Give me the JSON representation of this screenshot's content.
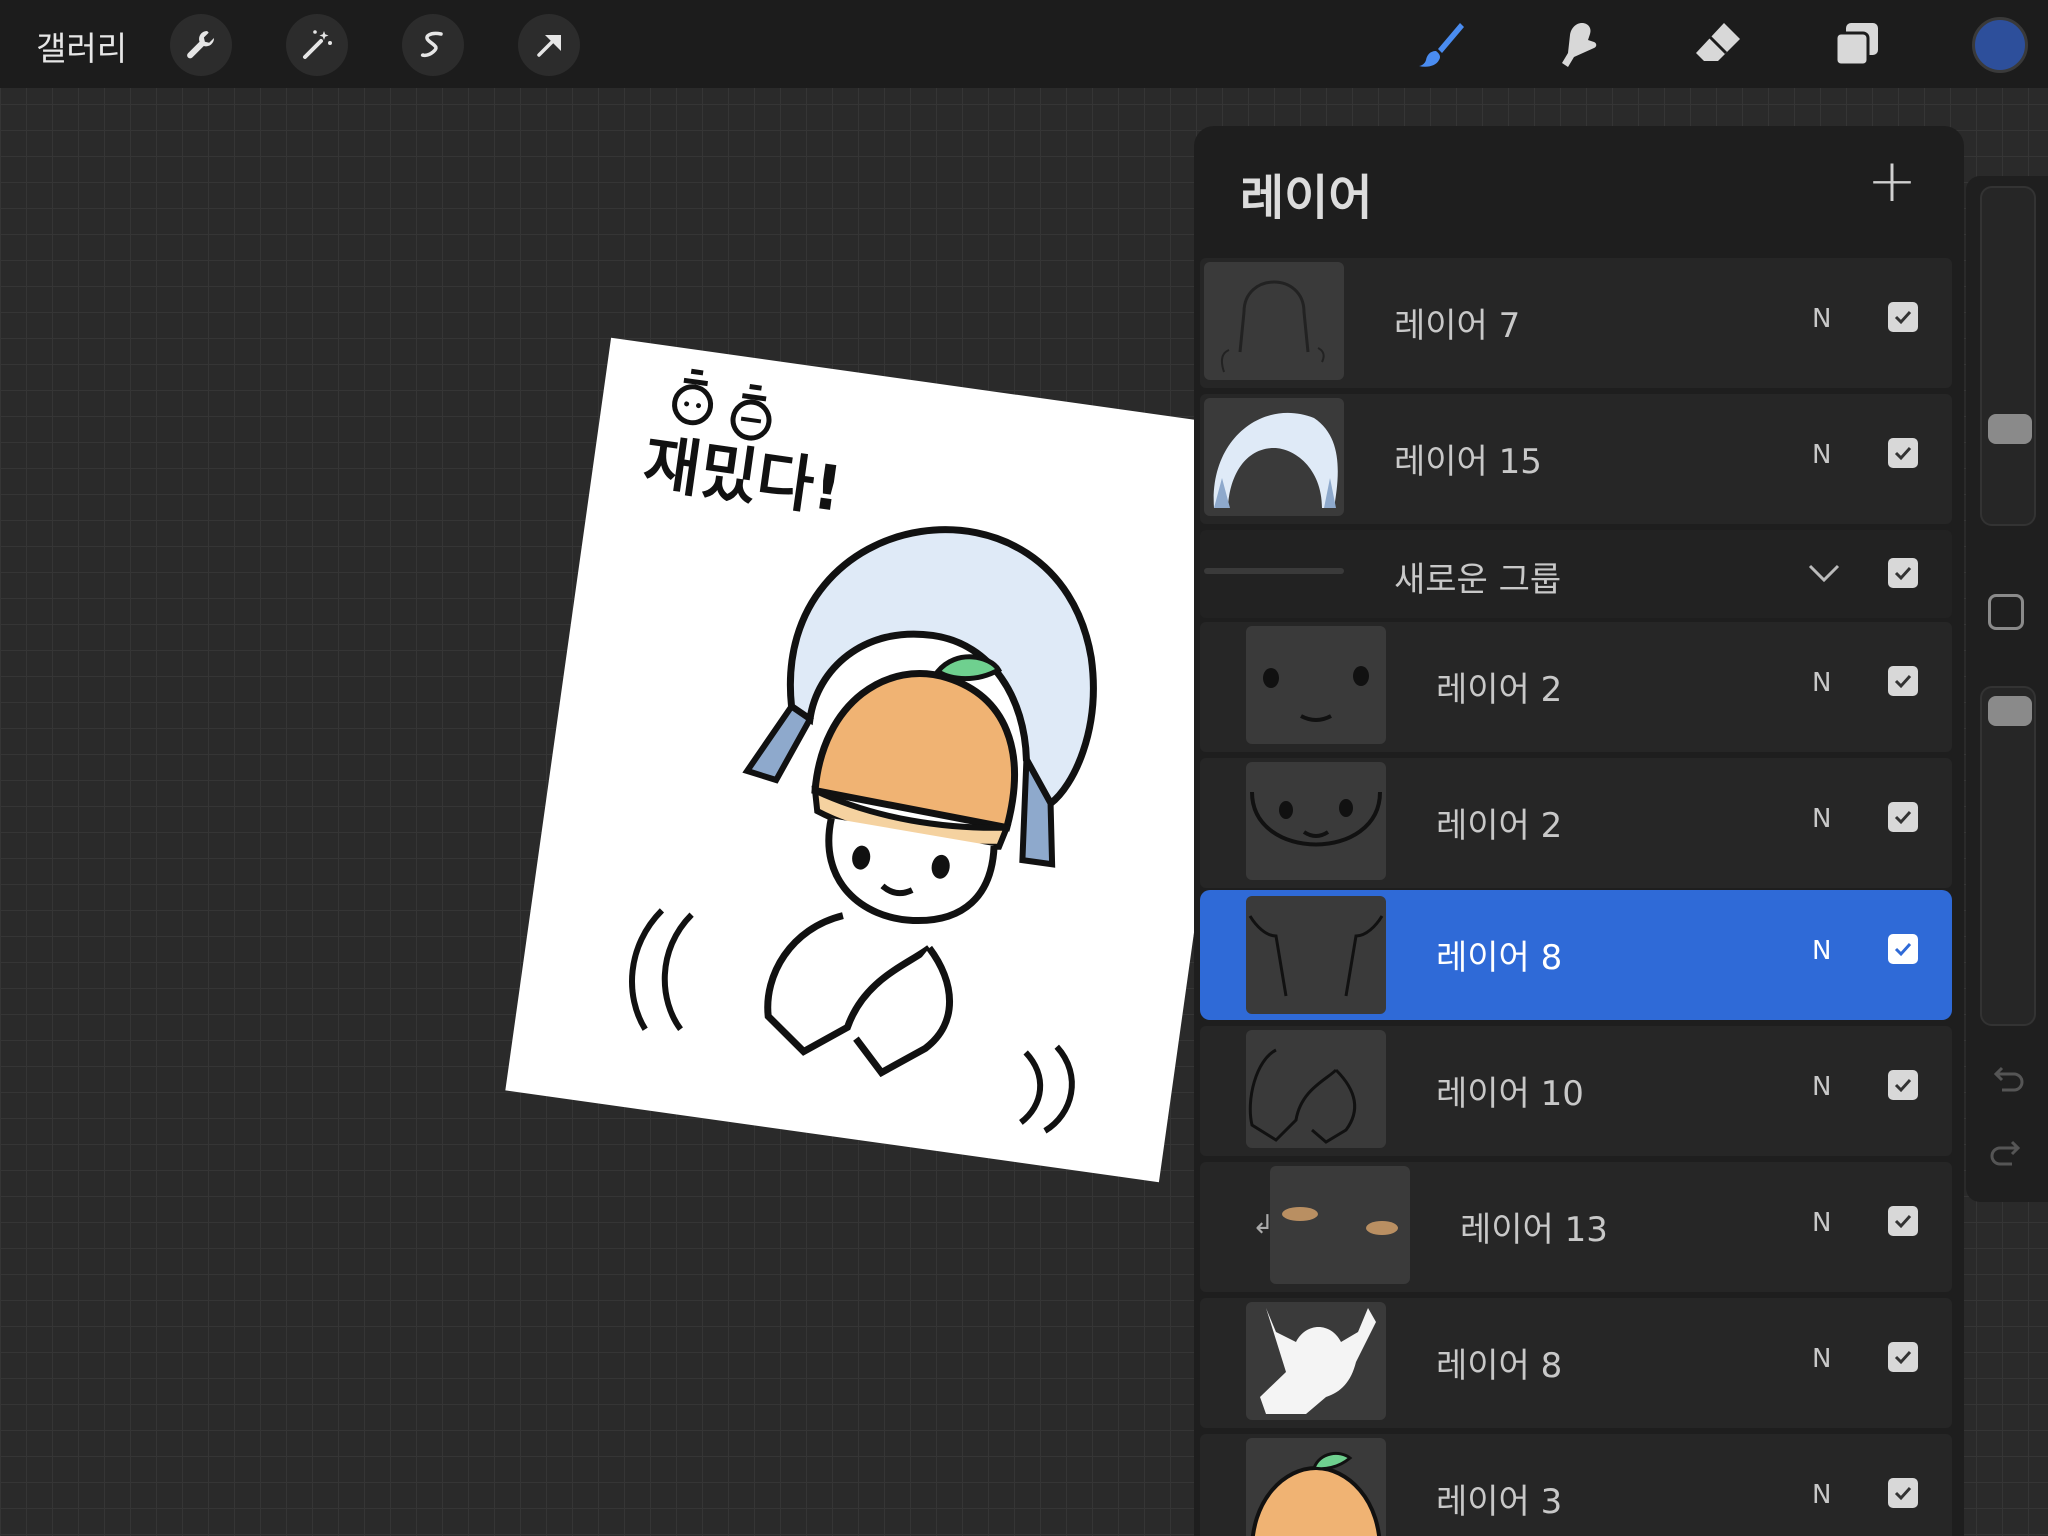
{
  "topbar": {
    "gallery_label": "갤러리",
    "tools_left": [
      "wrench-icon",
      "magic-wand-icon",
      "selection-icon",
      "transform-arrow-icon"
    ],
    "tools_right": [
      "brush-icon",
      "smudge-icon",
      "eraser-icon",
      "layers-icon"
    ],
    "active_tool": "brush-icon",
    "current_color": "#2d4f9b"
  },
  "artwork": {
    "caption": "재밌다!",
    "emoticon_prefix": "ㅎㅎ"
  },
  "layers_panel": {
    "title": "레이어",
    "add_button": "+",
    "layers": [
      {
        "name": "레이어 7",
        "blend": "N",
        "visible": true,
        "indent": false
      },
      {
        "name": "레이어 15",
        "blend": "N",
        "visible": true,
        "indent": false
      },
      {
        "name": "새로운 그룹",
        "type": "group",
        "visible": true,
        "expanded": true
      },
      {
        "name": "레이어 2",
        "blend": "N",
        "visible": true,
        "indent": true
      },
      {
        "name": "레이어 2",
        "blend": "N",
        "visible": true,
        "indent": true
      },
      {
        "name": "레이어 8",
        "blend": "N",
        "visible": true,
        "indent": true,
        "selected": true
      },
      {
        "name": "레이어 10",
        "blend": "N",
        "visible": true,
        "indent": true
      },
      {
        "name": "레이어 13",
        "blend": "N",
        "visible": true,
        "indent": true,
        "clipped": true
      },
      {
        "name": "레이어 8",
        "blend": "N",
        "visible": true,
        "indent": true
      },
      {
        "name": "레이어 3",
        "blend": "N",
        "visible": true,
        "indent": true
      }
    ]
  },
  "colors": {
    "selected_row": "#2f6ad7",
    "accent": "#4a8cf0"
  }
}
